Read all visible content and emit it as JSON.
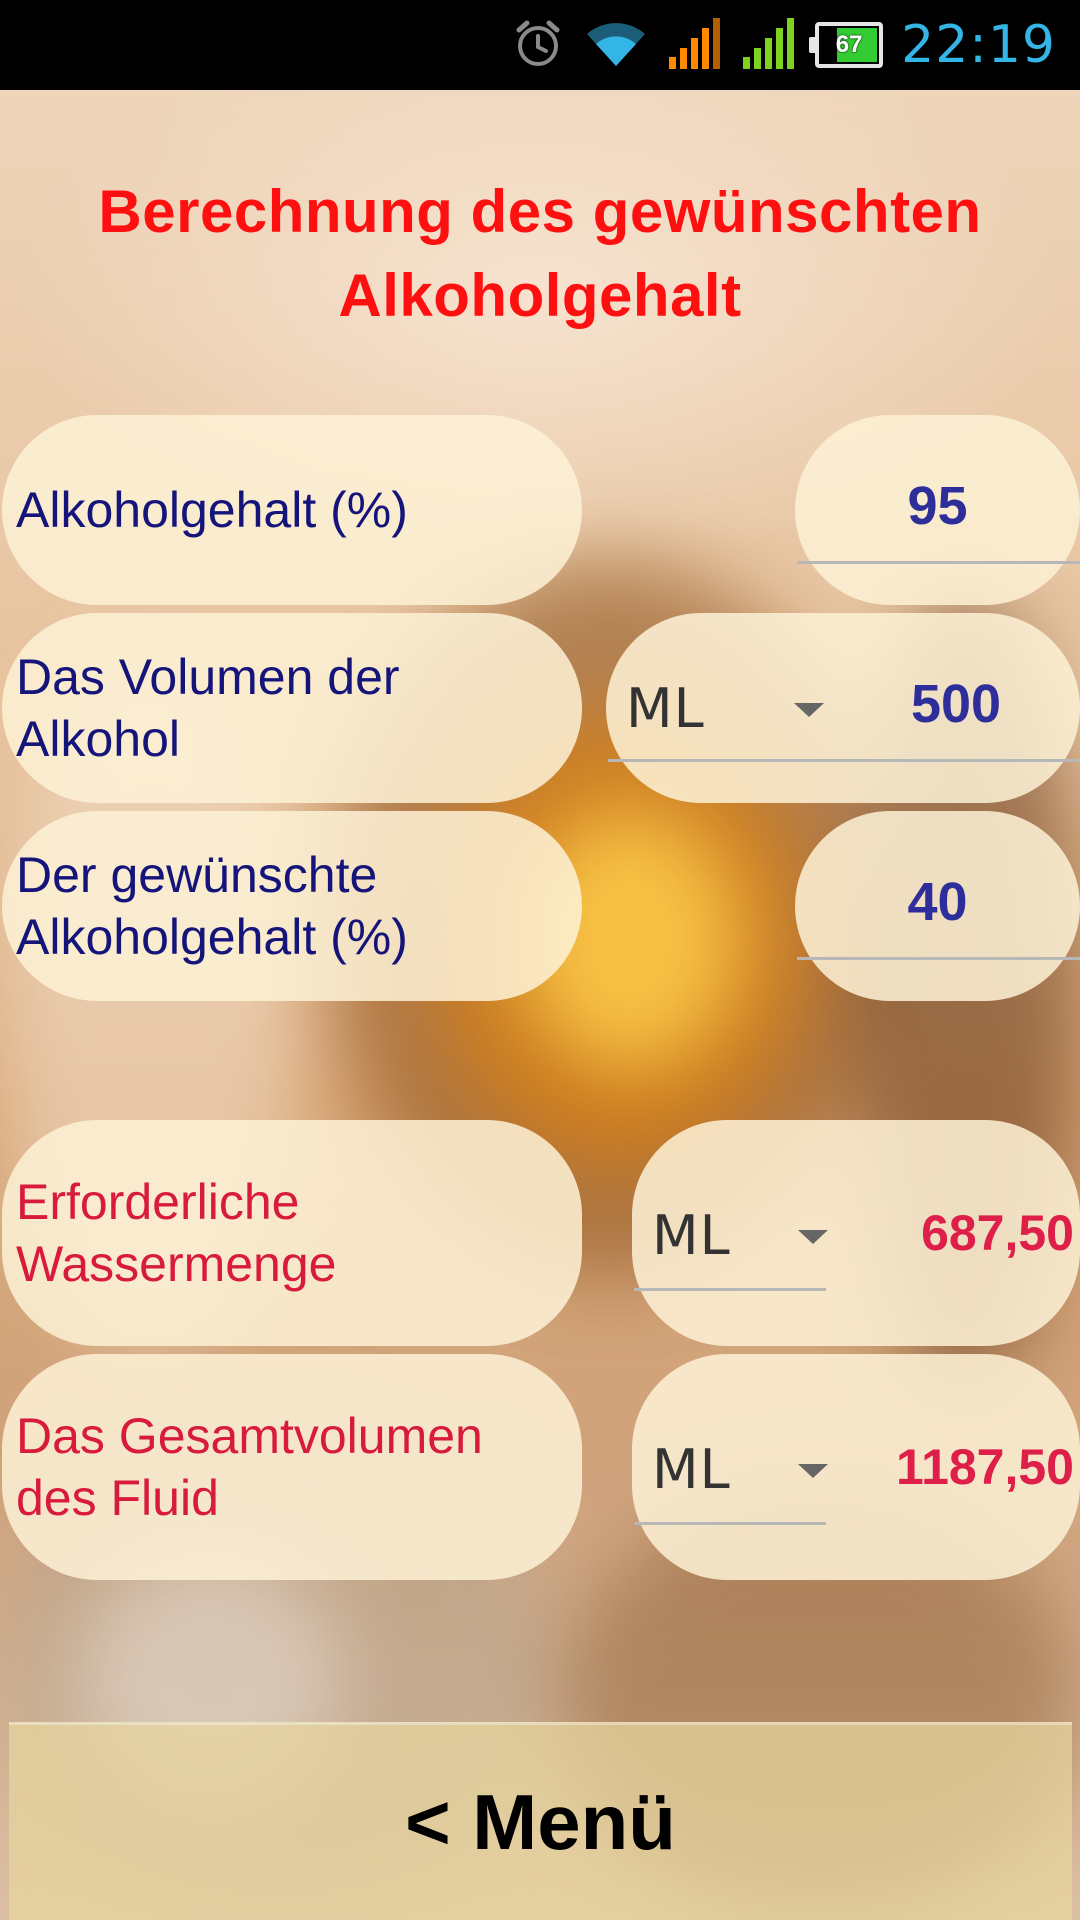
{
  "status_bar": {
    "time": "22:19",
    "battery_percent": "67",
    "icons": [
      "alarm-icon",
      "wifi-icon",
      "signal-icon",
      "signal-icon",
      "battery-icon"
    ],
    "colors": {
      "time": "#33b5e5",
      "wifi": "#33b5e5",
      "signal_sim1": "#ff8a00",
      "signal_sim2": "#7ed321"
    }
  },
  "title": {
    "line1": "Berechnung des gewünschten",
    "line2": "Alkoholgehalt",
    "color": "#ff1010"
  },
  "fields": {
    "alcohol_content": {
      "label": "Alkoholgehalt (%)",
      "value": "95"
    },
    "alcohol_volume": {
      "label_line1": "Das Volumen der",
      "label_line2": "Alkohol",
      "unit": "ML",
      "value": "500"
    },
    "desired_content": {
      "label_line1": "Der gewünschte",
      "label_line2": "Alkoholgehalt (%)",
      "value": "40"
    }
  },
  "results": {
    "water_needed": {
      "label_line1": "Erforderliche",
      "label_line2": "Wassermenge",
      "unit": "ML",
      "value": "687,50"
    },
    "total_volume": {
      "label_line1": "Das Gesamtvolumen",
      "label_line2": "des Fluid",
      "unit": "ML",
      "value": "1187,50"
    }
  },
  "menu_button": {
    "label": "< Menü"
  }
}
